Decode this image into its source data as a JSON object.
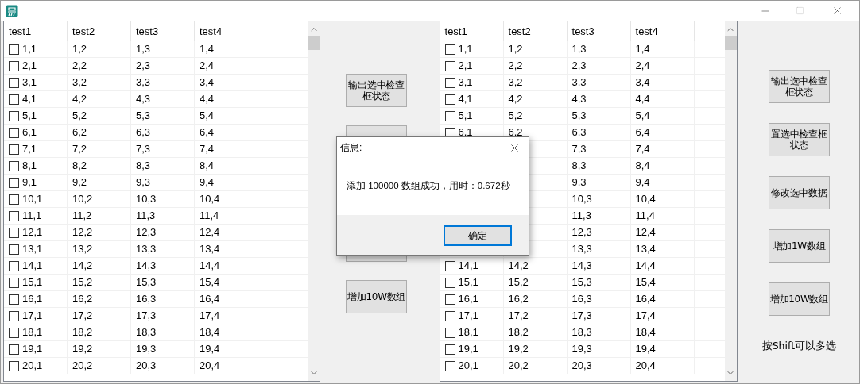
{
  "lists": [
    {
      "columns": [
        "test1",
        "test2",
        "test3",
        "test4"
      ],
      "rows": [
        {
          "checked": false,
          "cells": [
            "1,1",
            "1,2",
            "1,3",
            "1,4"
          ]
        },
        {
          "checked": false,
          "cells": [
            "2,1",
            "2,2",
            "2,3",
            "2,4"
          ]
        },
        {
          "checked": false,
          "cells": [
            "3,1",
            "3,2",
            "3,3",
            "3,4"
          ]
        },
        {
          "checked": false,
          "cells": [
            "4,1",
            "4,2",
            "4,3",
            "4,4"
          ]
        },
        {
          "checked": false,
          "cells": [
            "5,1",
            "5,2",
            "5,3",
            "5,4"
          ]
        },
        {
          "checked": false,
          "cells": [
            "6,1",
            "6,2",
            "6,3",
            "6,4"
          ]
        },
        {
          "checked": false,
          "cells": [
            "7,1",
            "7,2",
            "7,3",
            "7,4"
          ]
        },
        {
          "checked": false,
          "cells": [
            "8,1",
            "8,2",
            "8,3",
            "8,4"
          ]
        },
        {
          "checked": false,
          "cells": [
            "9,1",
            "9,2",
            "9,3",
            "9,4"
          ]
        },
        {
          "checked": false,
          "cells": [
            "10,1",
            "10,2",
            "10,3",
            "10,4"
          ]
        },
        {
          "checked": false,
          "cells": [
            "11,1",
            "11,2",
            "11,3",
            "11,4"
          ]
        },
        {
          "checked": false,
          "cells": [
            "12,1",
            "12,2",
            "12,3",
            "12,4"
          ]
        },
        {
          "checked": false,
          "cells": [
            "13,1",
            "13,2",
            "13,3",
            "13,4"
          ]
        },
        {
          "checked": false,
          "cells": [
            "14,1",
            "14,2",
            "14,3",
            "14,4"
          ]
        },
        {
          "checked": false,
          "cells": [
            "15,1",
            "15,2",
            "15,3",
            "15,4"
          ]
        },
        {
          "checked": false,
          "cells": [
            "16,1",
            "16,2",
            "16,3",
            "16,4"
          ]
        },
        {
          "checked": false,
          "cells": [
            "17,1",
            "17,2",
            "17,3",
            "17,4"
          ]
        },
        {
          "checked": false,
          "cells": [
            "18,1",
            "18,2",
            "18,3",
            "18,4"
          ]
        },
        {
          "checked": false,
          "cells": [
            "19,1",
            "19,2",
            "19,3",
            "19,4"
          ]
        },
        {
          "checked": false,
          "cells": [
            "20,1",
            "20,2",
            "20,3",
            "20,4"
          ]
        }
      ]
    },
    {
      "columns": [
        "test1",
        "test2",
        "test3",
        "test4"
      ],
      "rows": [
        {
          "checked": false,
          "cells": [
            "1,1",
            "1,2",
            "1,3",
            "1,4"
          ]
        },
        {
          "checked": false,
          "cells": [
            "2,1",
            "2,2",
            "2,3",
            "2,4"
          ]
        },
        {
          "checked": false,
          "cells": [
            "3,1",
            "3,2",
            "3,3",
            "3,4"
          ]
        },
        {
          "checked": false,
          "cells": [
            "4,1",
            "4,2",
            "4,3",
            "4,4"
          ]
        },
        {
          "checked": false,
          "cells": [
            "5,1",
            "5,2",
            "5,3",
            "5,4"
          ]
        },
        {
          "checked": false,
          "cells": [
            "6,1",
            "6,2",
            "6,3",
            "6,4"
          ]
        },
        {
          "cells": [
            null,
            null,
            "7,3",
            "7,4"
          ]
        },
        {
          "cells": [
            null,
            null,
            "8,3",
            "8,4"
          ]
        },
        {
          "cells": [
            null,
            null,
            "9,3",
            "9,4"
          ]
        },
        {
          "cells": [
            null,
            null,
            "10,3",
            "10,4"
          ]
        },
        {
          "cells": [
            null,
            null,
            "11,3",
            "11,4"
          ]
        },
        {
          "cells": [
            null,
            null,
            "12,3",
            "12,4"
          ]
        },
        {
          "cells": [
            null,
            null,
            "13,3",
            "13,4"
          ]
        },
        {
          "checked": false,
          "cells": [
            "14,1",
            "14,2",
            "14,3",
            "14,4"
          ]
        },
        {
          "checked": false,
          "cells": [
            "15,1",
            "15,2",
            "15,3",
            "15,4"
          ]
        },
        {
          "checked": false,
          "cells": [
            "16,1",
            "16,2",
            "16,3",
            "16,4"
          ]
        },
        {
          "checked": false,
          "cells": [
            "17,1",
            "17,2",
            "17,3",
            "17,4"
          ]
        },
        {
          "checked": false,
          "cells": [
            "18,1",
            "18,2",
            "18,3",
            "18,4"
          ]
        },
        {
          "checked": false,
          "cells": [
            "19,1",
            "19,2",
            "19,3",
            "19,4"
          ]
        },
        {
          "checked": false,
          "cells": [
            "20,1",
            "20,2",
            "20,3",
            "20,4"
          ]
        }
      ]
    }
  ],
  "left_buttons": [
    {
      "kind": "button",
      "label": "输出选中检查框状态"
    },
    {
      "kind": "covered"
    },
    {
      "kind": "gap"
    },
    {
      "kind": "covered"
    },
    {
      "kind": "button",
      "label": "增加10W数组"
    }
  ],
  "right_buttons": [
    {
      "kind": "button",
      "label": "输出选中检查框状态"
    },
    {
      "kind": "button",
      "label": "置选中检查框状态"
    },
    {
      "kind": "button",
      "label": "修改选中数据"
    },
    {
      "kind": "button",
      "label": "增加1W数组"
    },
    {
      "kind": "button",
      "label": "增加10W数组"
    }
  ],
  "hint": "按Shift可以多选",
  "dialog": {
    "title": "信息:",
    "message": "添加 100000 数组成功，用时：0.672秒",
    "button": "确定"
  }
}
